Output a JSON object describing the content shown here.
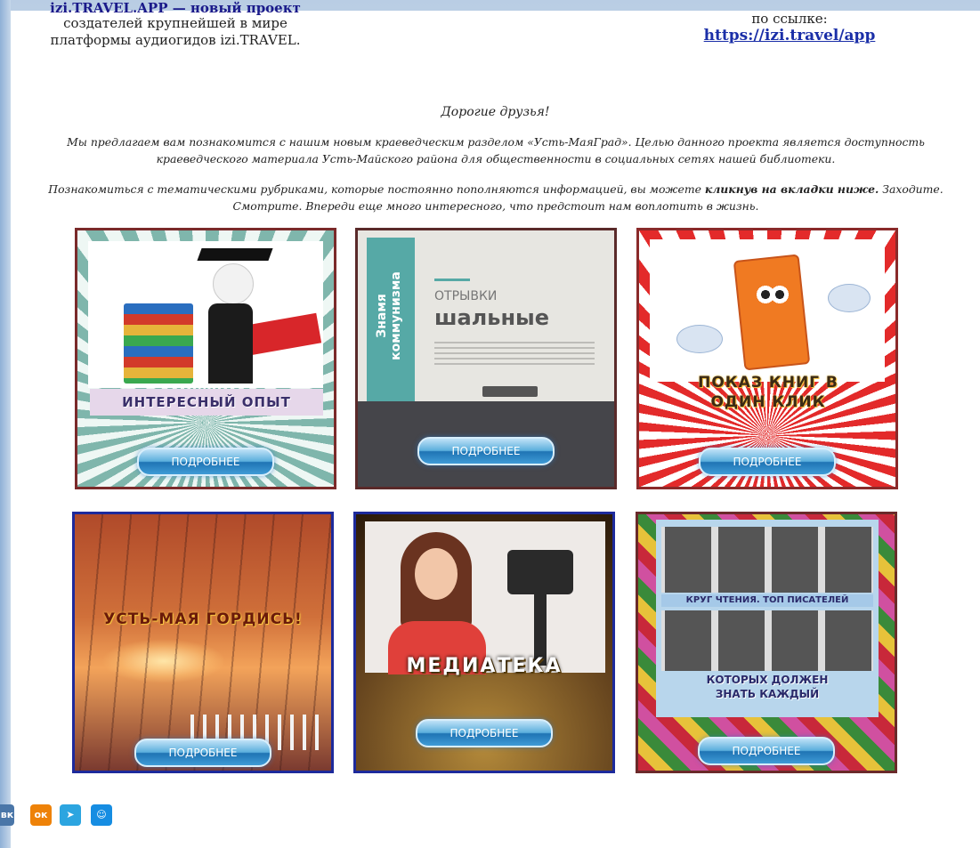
{
  "top_left": {
    "link_cut": "izi.TRAVEL.APP — новый проект",
    "line2": "создателей крупнейшей в мире",
    "line3": "платформы аудиогидов izi.TRAVEL."
  },
  "top_right": {
    "line1": "по ссылке:",
    "link": "https://izi.travel/app"
  },
  "greeting": "Дорогие друзья!",
  "para1": "Мы предлагаем вам познакомится с нашим новым краеведческим разделом «Усть-МаяГрад». Целью данного проекта является доступность краеведческого материала Усть-Майского района для общественности в социальных сетях нашей библиотеки.",
  "para2_start": "Познакомиться с тематическими рубриками, которые постоянно пополняются информацией, вы можете ",
  "para2_bold": "кликнув на вкладки ниже.",
  "para2_end": " Заходите. Смотрите. Впереди еще много интересного, что предстоит нам воплотить в жизнь.",
  "tiles": [
    {
      "label": "ИНТЕРЕСНЫЙ ОПЫТ",
      "button": "ПОДРОБНЕЕ"
    },
    {
      "label": "Знамя коммунизма",
      "subtitle": "ОТРЫВКИ",
      "title": "шальные",
      "button": "ПОДРОБНЕЕ"
    },
    {
      "label": "ПОКАЗ КНИГ В ОДИН КЛИК",
      "button": "ПОДРОБНЕЕ"
    },
    {
      "label": "УСТЬ-МАЯ ГОРДИСЬ!",
      "button": "ПОДРОБНЕЕ"
    },
    {
      "label": "МЕДИАТЕКА",
      "button": "ПОДРОБНЕЕ"
    },
    {
      "label_top": "КРУГ ЧТЕНИЯ. ТОП ПИСАТЕЛЕЙ",
      "label_bottom": "КОТОРЫХ ДОЛЖЕН ЗНАТЬ КАЖДЫЙ",
      "button": "ПОДРОБНЕЕ"
    }
  ],
  "social": [
    {
      "icon": "vk-icon",
      "text": "вк",
      "color": "#4a76a8"
    },
    {
      "icon": "odnoklassniki-icon",
      "text": "ок",
      "color": "#ee8208"
    },
    {
      "icon": "telegram-icon",
      "text": "➤",
      "color": "#2ca5e0"
    },
    {
      "icon": "moimir-icon",
      "text": "☺",
      "color": "#168de2"
    }
  ]
}
